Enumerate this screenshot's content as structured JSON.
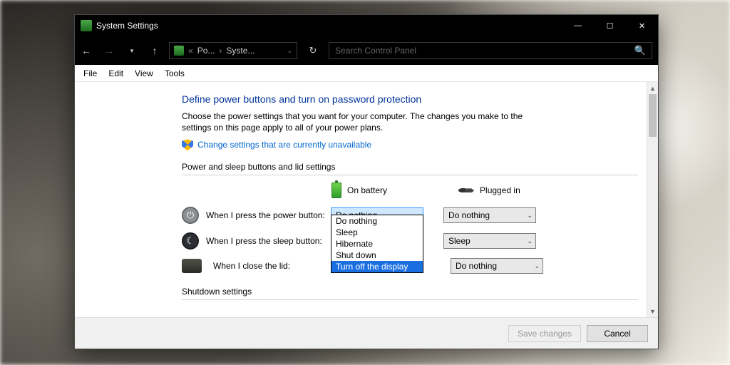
{
  "window": {
    "title": "System Settings"
  },
  "nav": {
    "crumb1": "Po...",
    "crumb2": "Syste...",
    "search_placeholder": "Search Control Panel"
  },
  "menu": {
    "file": "File",
    "edit": "Edit",
    "view": "View",
    "tools": "Tools"
  },
  "page": {
    "heading": "Define power buttons and turn on password protection",
    "desc": "Choose the power settings that you want for your computer. The changes you make to the settings on this page apply to all of your power plans.",
    "change_link": "Change settings that are currently unavailable",
    "section1": "Power and sleep buttons and lid settings",
    "col_battery": "On battery",
    "col_plugged": "Plugged in",
    "rows": {
      "power": "When I press the power button:",
      "sleep": "When I press the sleep button:",
      "lid": "When I close the lid:"
    },
    "values": {
      "power_battery": "Do nothing",
      "power_plugged": "Do nothing",
      "sleep_plugged": "Sleep",
      "lid_plugged": "Do nothing"
    },
    "dropdown_options": [
      "Do nothing",
      "Sleep",
      "Hibernate",
      "Shut down",
      "Turn off the display"
    ],
    "dropdown_highlight": "Turn off the display",
    "section2": "Shutdown settings"
  },
  "footer": {
    "save": "Save changes",
    "cancel": "Cancel"
  }
}
